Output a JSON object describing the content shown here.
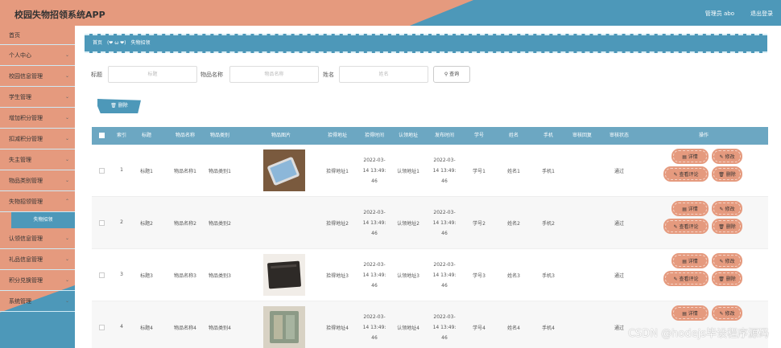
{
  "header": {
    "app_title": "校园失物招领系统APP",
    "user": "管理员 abo",
    "logout": "退出登录"
  },
  "sidebar": {
    "items": [
      {
        "label": "首页",
        "chevron": false
      },
      {
        "label": "个人中心",
        "chevron": true
      },
      {
        "label": "校园信息管理",
        "chevron": true
      },
      {
        "label": "学生管理",
        "chevron": true
      },
      {
        "label": "增加积分管理",
        "chevron": true
      },
      {
        "label": "扣减积分管理",
        "chevron": true
      },
      {
        "label": "失主管理",
        "chevron": true
      },
      {
        "label": "物品类别管理",
        "chevron": true
      },
      {
        "label": "失物招领管理",
        "chevron": true
      }
    ],
    "active_sub": "失物招领",
    "items_after": [
      {
        "label": "认领信息管理",
        "chevron": true
      },
      {
        "label": "礼品信息管理",
        "chevron": true
      },
      {
        "label": "积分兑换管理",
        "chevron": true
      },
      {
        "label": "系统管理",
        "chevron": true
      }
    ]
  },
  "breadcrumb": {
    "home": "首页",
    "emoji": "(❤ ω ❤)",
    "current": "失物招领"
  },
  "search": {
    "title_label": "标题",
    "title_placeholder": "标题",
    "name_label": "物品名称",
    "name_placeholder": "物品名称",
    "person_label": "姓名",
    "person_placeholder": "姓名",
    "button": "查询"
  },
  "toolbar": {
    "delete": "删除"
  },
  "table": {
    "headers": [
      "索引",
      "标题",
      "物品名称",
      "物品类别",
      "物品图片",
      "拾得地址",
      "拾得时间",
      "认领地址",
      "发布时间",
      "学号",
      "姓名",
      "手机",
      "审核回复",
      "审核状态",
      "操作"
    ],
    "rows": [
      {
        "idx": "1",
        "title": "标题1",
        "name": "物品名称1",
        "cat": "物品类别1",
        "image": "phone",
        "addr": "拾得地址1",
        "time": "2022-03-14 13:49:46",
        "claim": "认领地址1",
        "pub": "2022-03-14 13:49:46",
        "sid": "学号1",
        "pname": "姓名1",
        "phone": "手机1",
        "reply": "",
        "status": "通过"
      },
      {
        "idx": "2",
        "title": "标题2",
        "name": "物品名称2",
        "cat": "物品类别2",
        "image": "",
        "addr": "拾得地址2",
        "time": "2022-03-14 13:49:46",
        "claim": "认领地址2",
        "pub": "2022-03-14 13:49:46",
        "sid": "学号2",
        "pname": "姓名2",
        "phone": "手机2",
        "reply": "",
        "status": "通过"
      },
      {
        "idx": "3",
        "title": "标题3",
        "name": "物品名称3",
        "cat": "物品类别3",
        "image": "wallet",
        "addr": "拾得地址3",
        "time": "2022-03-14 13:49:46",
        "claim": "认领地址3",
        "pub": "2022-03-14 13:49:46",
        "sid": "学号3",
        "pname": "姓名3",
        "phone": "手机3",
        "reply": "",
        "status": "通过"
      },
      {
        "idx": "4",
        "title": "标题4",
        "name": "物品名称4",
        "cat": "物品类别4",
        "image": "wallet-open",
        "addr": "拾得地址4",
        "time": "2022-03-14 13:49:46",
        "claim": "认领地址4",
        "pub": "2022-03-14 13:49:46",
        "sid": "学号4",
        "pname": "姓名4",
        "phone": "手机4",
        "reply": "",
        "status": "通过"
      }
    ],
    "actions": {
      "detail": "详情",
      "edit": "修改",
      "comments": "查看评论",
      "delete": "删除"
    }
  },
  "watermark": "CSDN @hodejs毕设程序源码",
  "colors": {
    "accent_orange": "#e59a7e",
    "accent_blue": "#4d98b9"
  }
}
